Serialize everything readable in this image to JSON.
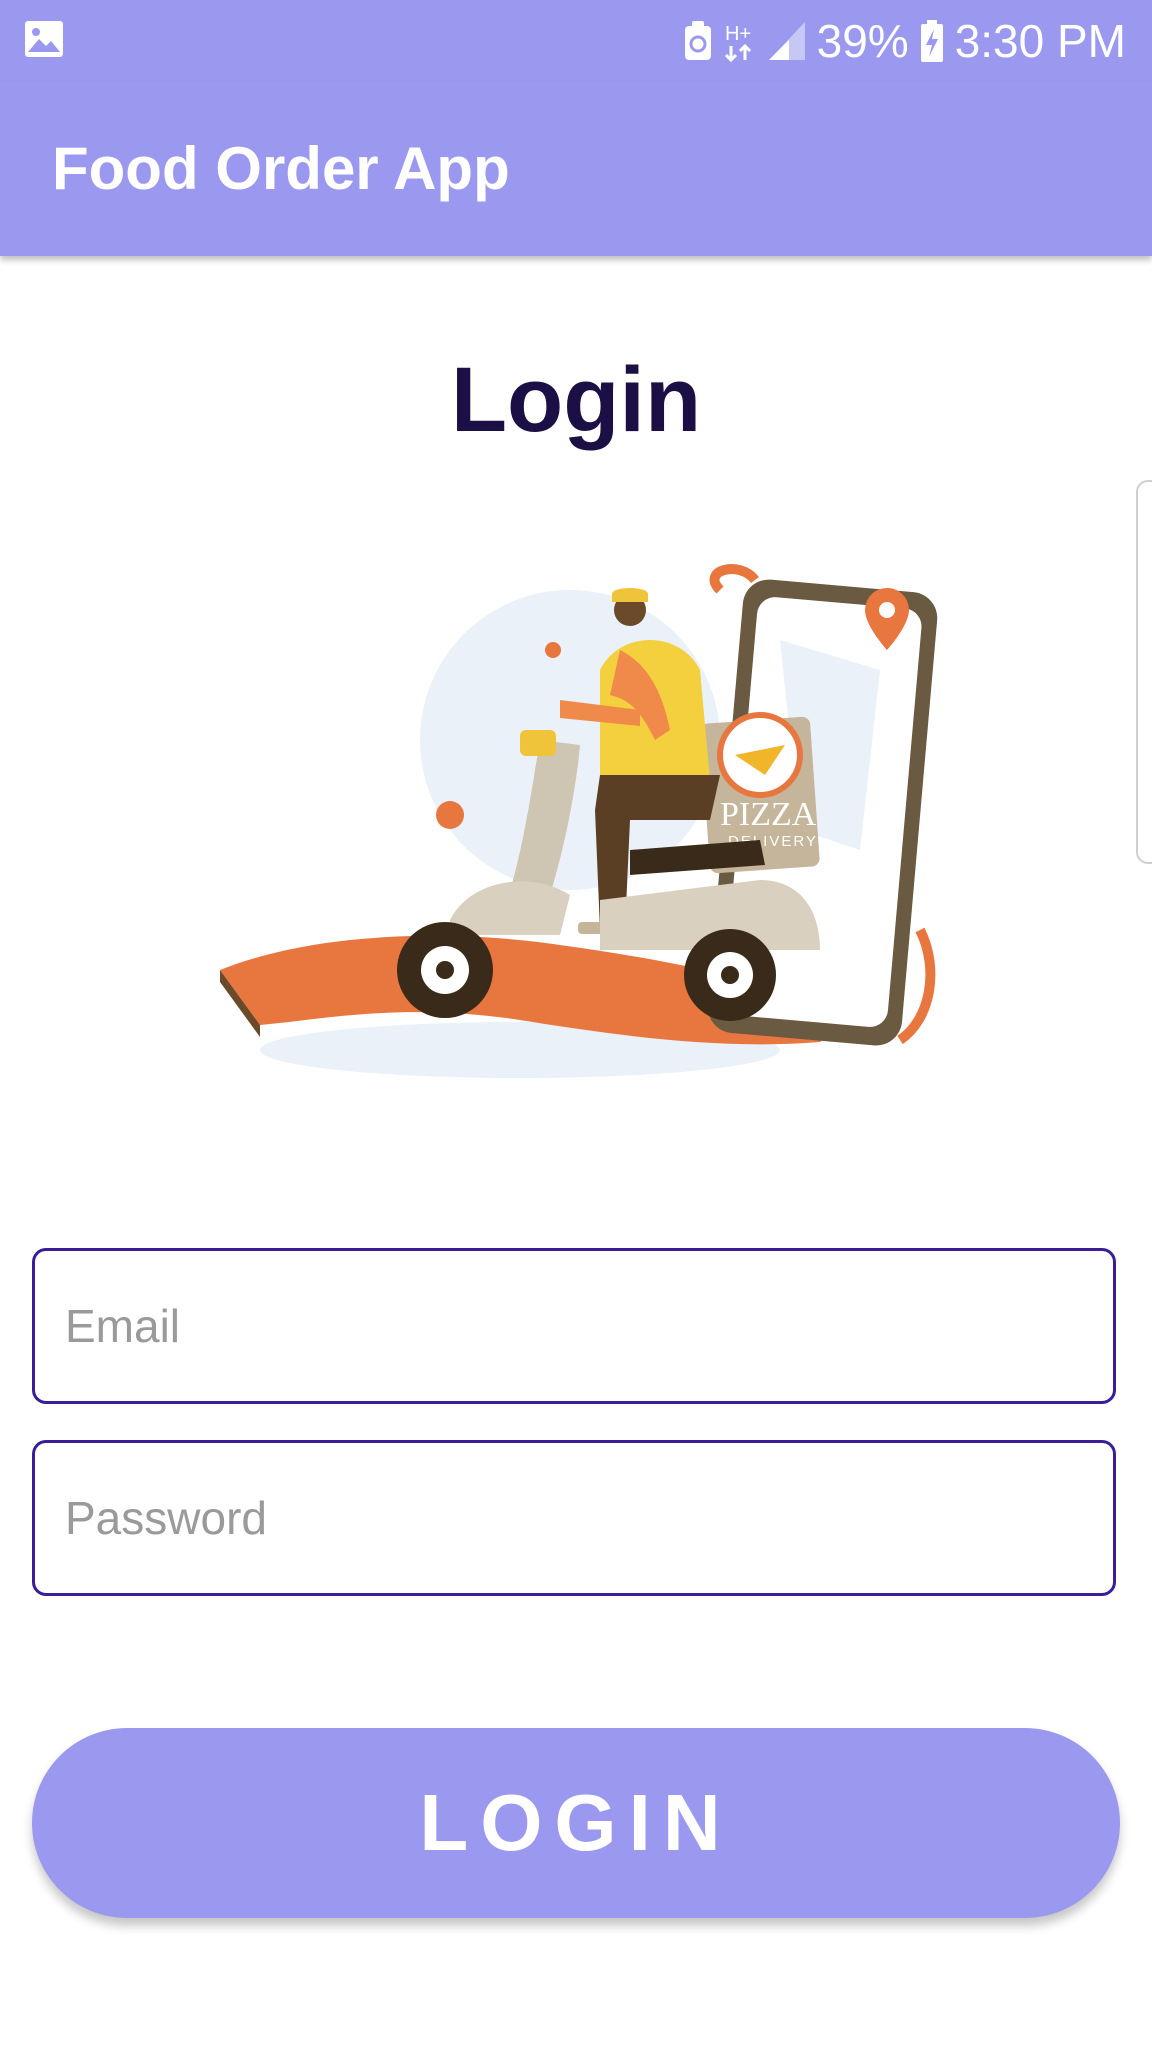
{
  "status_bar": {
    "network": "H+",
    "battery_percent": "39%",
    "time": "3:30 PM",
    "icons": [
      "gallery-icon",
      "notification-icon",
      "network-icon",
      "signal-icon",
      "battery-charging-icon"
    ]
  },
  "app_bar": {
    "title": "Food Order App"
  },
  "login": {
    "title": "Login",
    "illustration": {
      "box_text": "PIZZA",
      "box_subtext": "DELIVERY"
    },
    "email_placeholder": "Email",
    "password_placeholder": "Password",
    "button_label": "LOGIN"
  },
  "colors": {
    "primary": "#9a99ef",
    "title": "#1c0f45",
    "field_border": "#3b1d9a",
    "accent_orange": "#e8773f"
  }
}
